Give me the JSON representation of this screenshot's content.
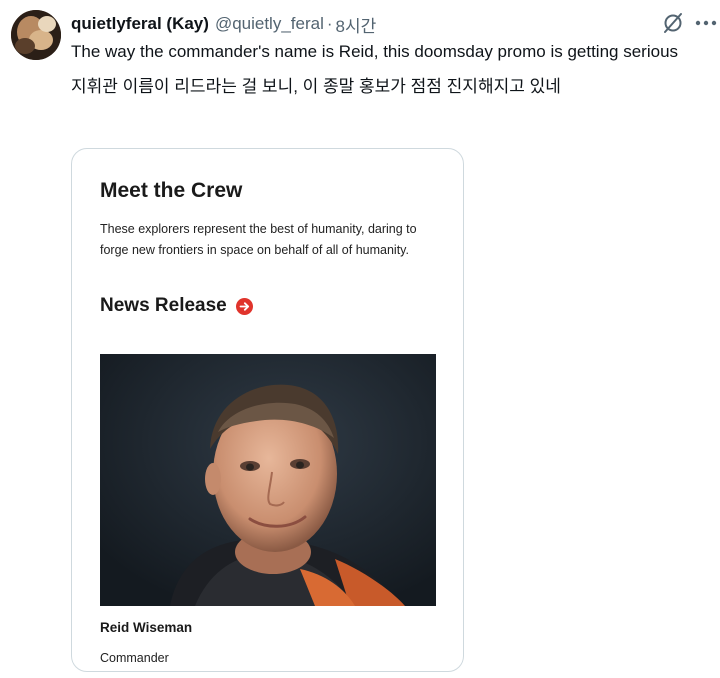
{
  "tweet": {
    "author": {
      "display_name": "quietlyferal (Kay)",
      "handle": "@quietly_feral",
      "separator": "·",
      "time": "8시간"
    },
    "icons": {
      "grok": "grok-icon",
      "more": "more-icon"
    },
    "text_line_1": "The way the commander's name is Reid, this doomsday promo is getting serious",
    "text_line_2": "지휘관 이름이 리드라는 걸 보니, 이 종말 홍보가 점점 진지해지고 있네"
  },
  "card": {
    "title": "Meet the Crew",
    "description": "These explorers represent the best of humanity, daring to forge new frontiers in space on behalf of all of humanity.",
    "news_label": "News Release",
    "news_icon": "arrow-right-circle-icon",
    "accent_color": "#e0342c",
    "person": {
      "name": "Reid Wiseman",
      "role": "Commander"
    }
  }
}
